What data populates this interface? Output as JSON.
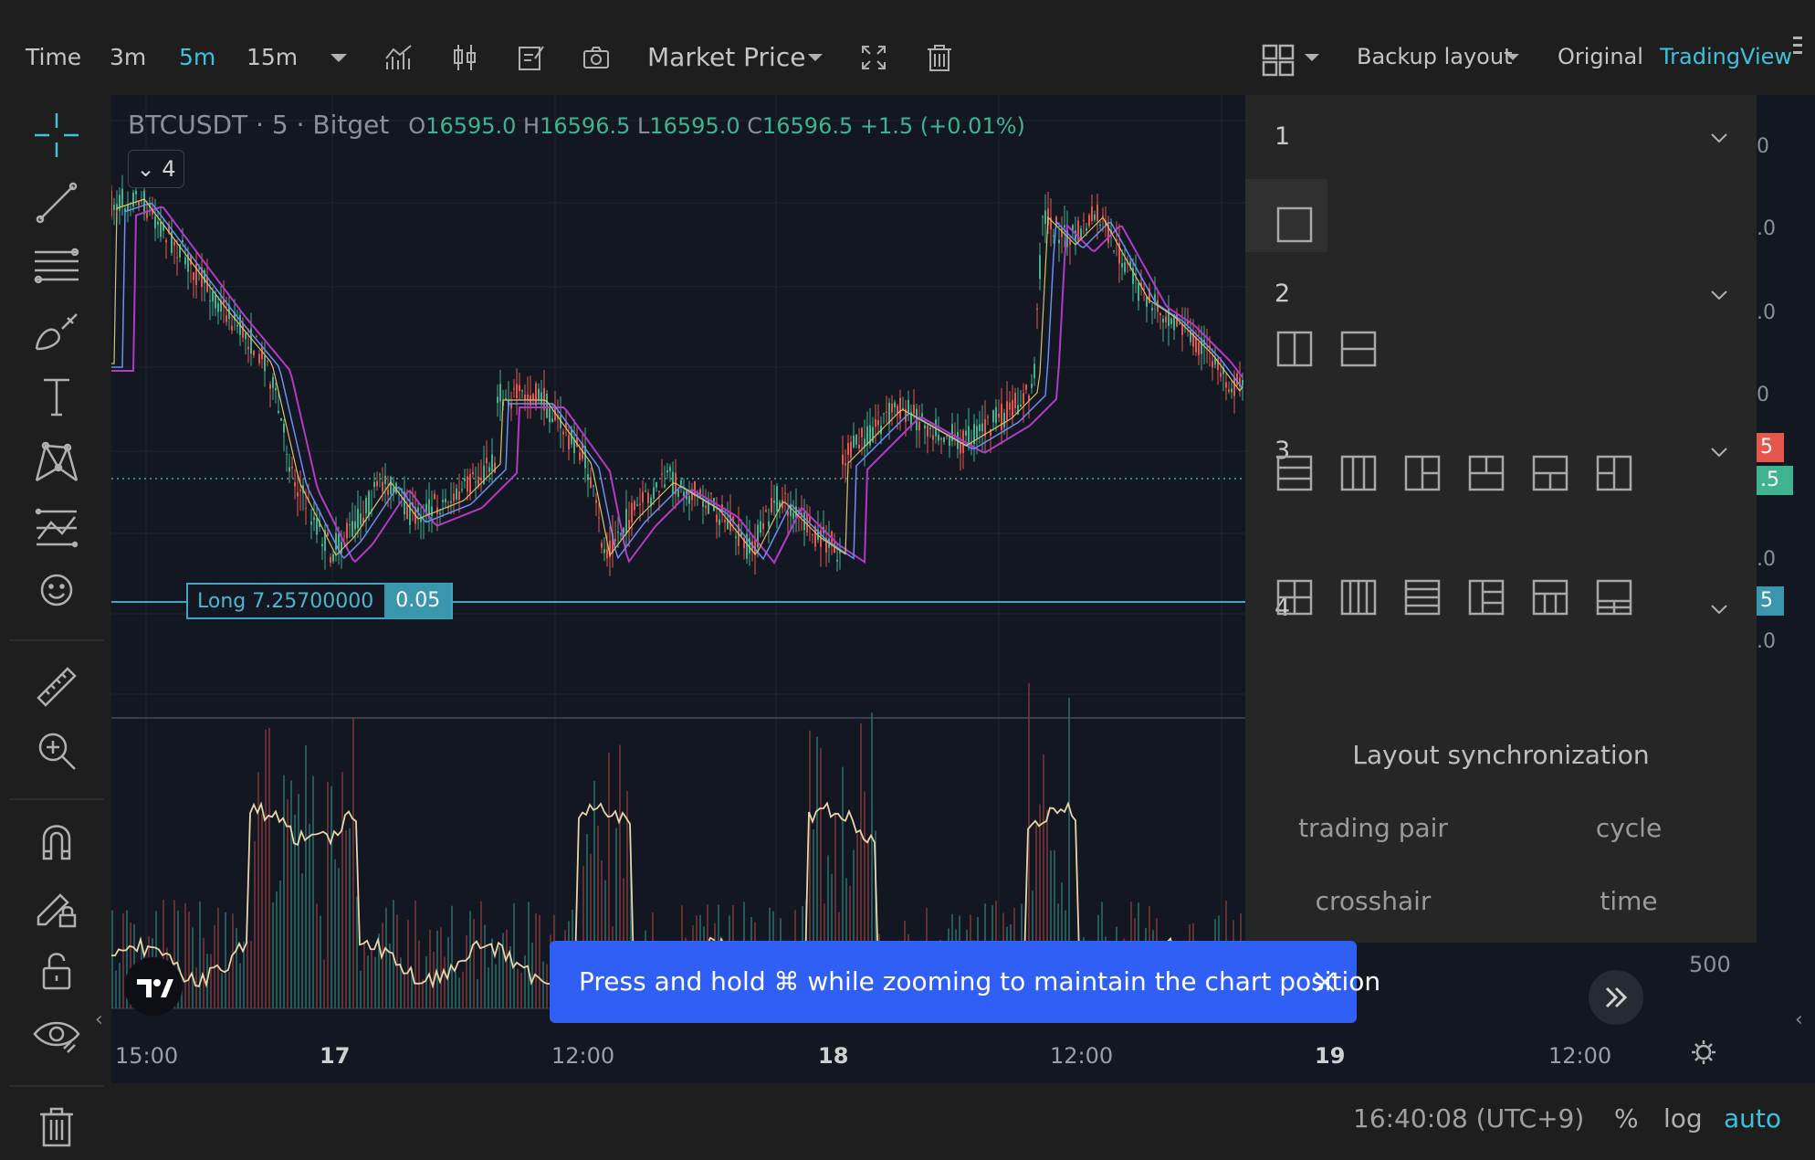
{
  "toolbar": {
    "time_label": "Time",
    "intervals": [
      "3m",
      "5m",
      "15m"
    ],
    "active_interval": "5m",
    "price_type": "Market Price",
    "backup_layout": "Backup layout",
    "view_original": "Original",
    "view_tradingview": "TradingView",
    "active_view": "TradingView"
  },
  "chart": {
    "symbol": "BTCUSDT",
    "interval": "5",
    "exchange": "Bitget",
    "ohlc": {
      "o": "16595.0",
      "h": "16596.5",
      "l": "16595.0",
      "c": "16596.5",
      "change": "+1.5 (+0.01%)"
    },
    "indicator_count": "4",
    "position_label": "Long 7.25700000",
    "position_qty": "0.05",
    "volume_axis_label": "500",
    "price_axis_fragments": [
      "0",
      ".0",
      ".0",
      "0",
      "5",
      ".5",
      ".0",
      "5",
      ".0"
    ],
    "time_labels": [
      "15:00",
      "17",
      "12:00",
      "18",
      "12:00",
      "19",
      "12:00"
    ],
    "day_labels": [
      "17",
      "18",
      "19"
    ]
  },
  "layout_popup": {
    "sections": [
      {
        "number": "1",
        "layouts": 1
      },
      {
        "number": "2",
        "layouts": 2
      },
      {
        "number": "3",
        "layouts": 6
      },
      {
        "number": "4",
        "layouts": 6
      }
    ],
    "sync_title": "Layout synchronization",
    "sync_options": [
      "trading pair",
      "cycle",
      "crosshair",
      "time"
    ]
  },
  "toast": {
    "message": "Press and hold ⌘ while zooming to maintain the chart position"
  },
  "footer": {
    "clock": "16:40:08 (UTC+9)",
    "percent": "%",
    "log": "log",
    "auto": "auto"
  },
  "colors": {
    "accent": "#3ec1dc",
    "up": "#3eb38e",
    "down": "#e5574b",
    "toast": "#2f5ff5",
    "chart_bg": "#131722",
    "popup_bg": "#262626"
  },
  "icons": {
    "toolbar": [
      "chevron-down-icon",
      "indicators-icon",
      "candle-type-icon",
      "edit-note-icon",
      "camera-icon",
      "fullscreen-icon",
      "trash-icon",
      "layout-grid-icon",
      "hamburger-icon"
    ],
    "sidebar": [
      "crosshair-icon",
      "trend-line-icon",
      "fib-lines-icon",
      "brush-icon",
      "text-icon",
      "pattern-icon",
      "forecast-icon",
      "emoji-icon",
      "ruler-icon",
      "zoom-icon",
      "magnet-icon",
      "lock-draw-icon",
      "unlock-icon",
      "eye-icon",
      "trash-icon"
    ]
  }
}
